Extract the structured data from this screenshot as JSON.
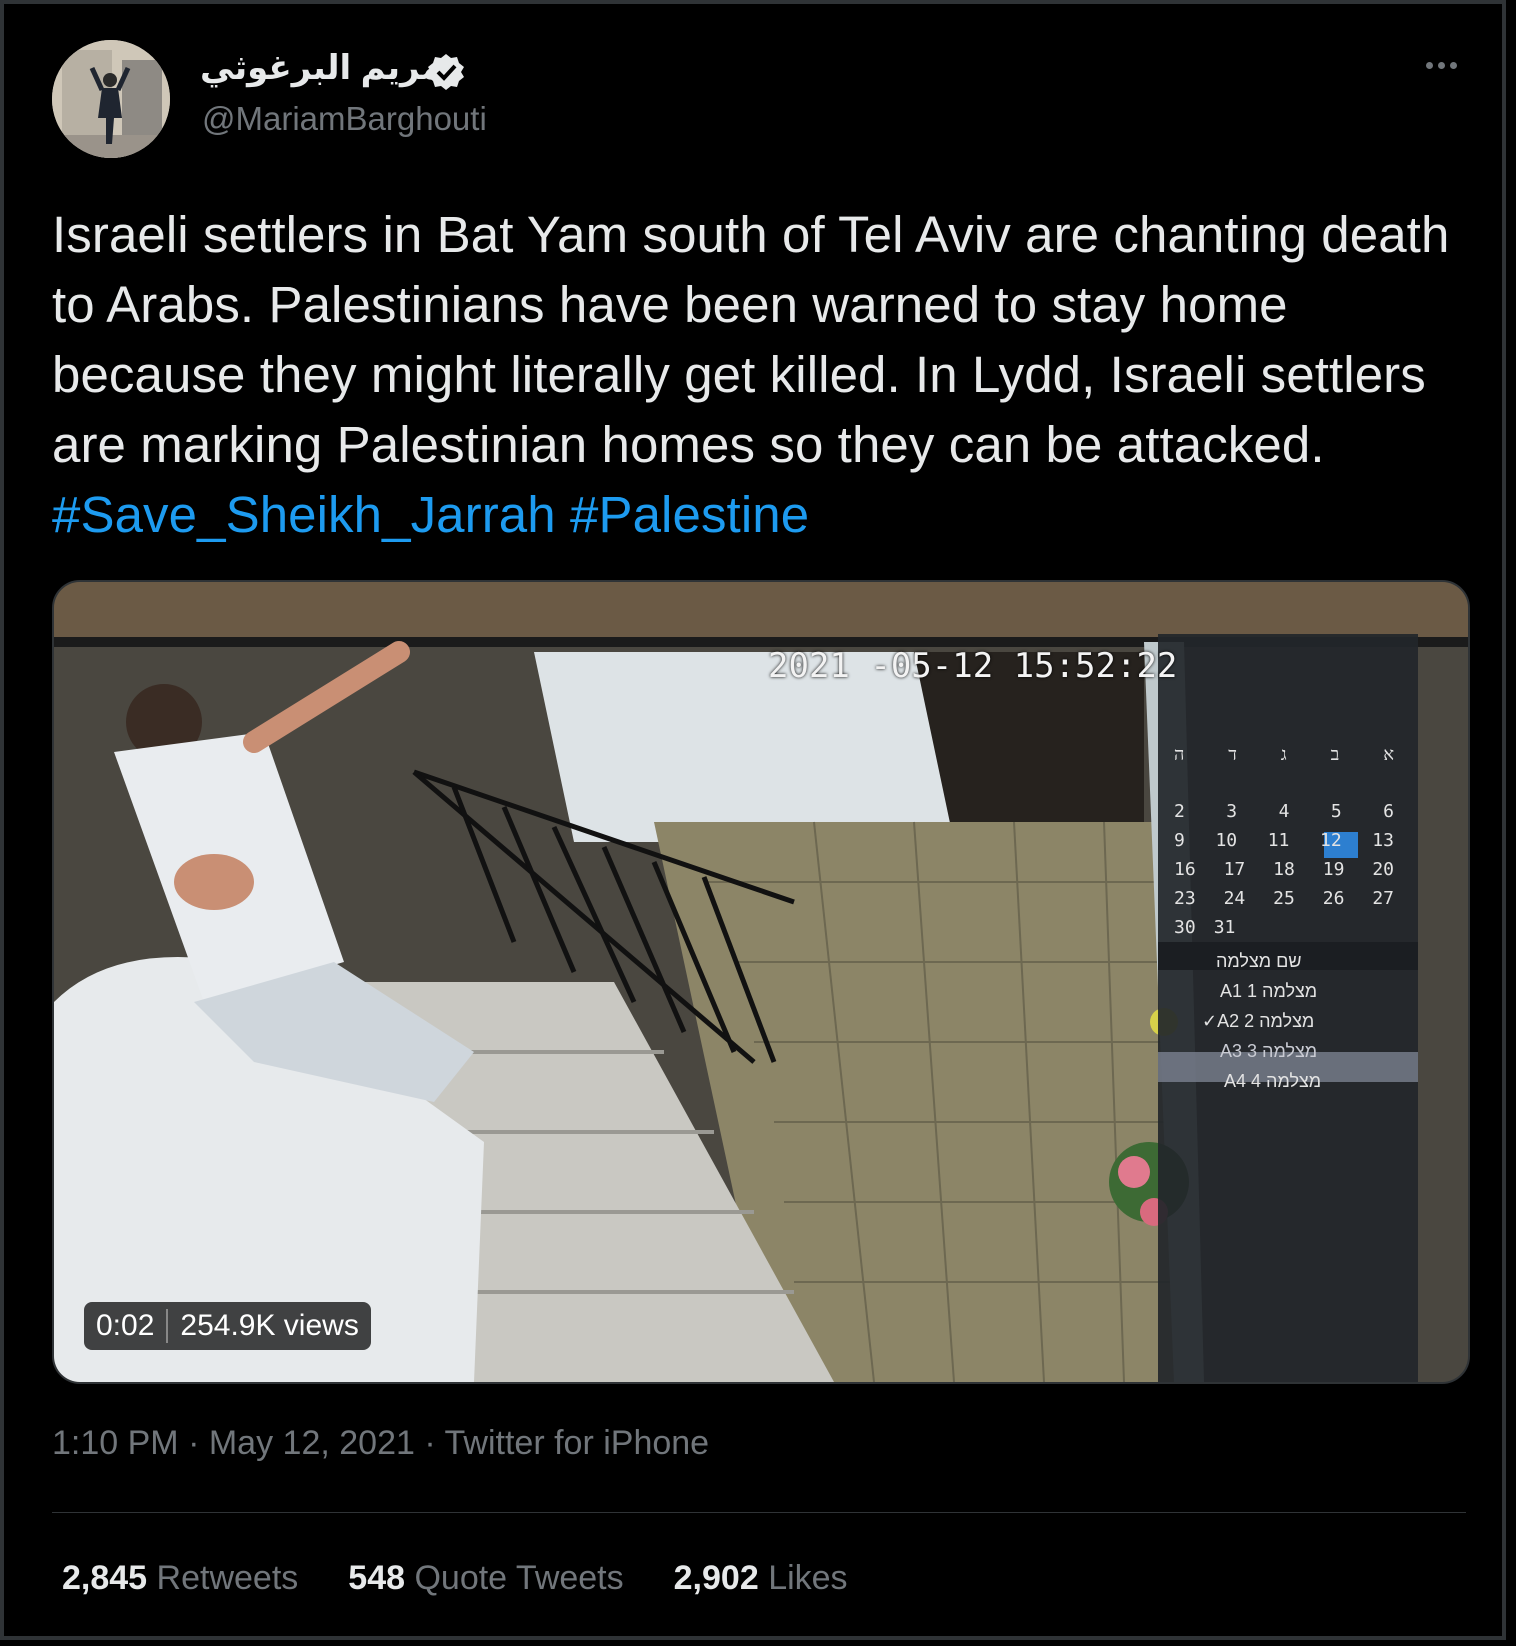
{
  "tweet": {
    "display_name": "مريم البرغوثي",
    "handle": "@MariamBarghouti",
    "verified_icon": "verified-badge-icon",
    "more_icon": "more-options-icon",
    "text_plain": "Israeli settlers in Bat Yam south of Tel Aviv are chanting death to Arabs. Palestinians have been warned to stay home because they might literally get killed. In Lydd, Israeli settlers are marking Palestinian homes so they can be attacked.",
    "hashtags": [
      "#Save_Sheikh_Jarrah",
      "#Palestine"
    ],
    "hashtag_color": "#1d9bf0"
  },
  "video": {
    "cctv_timestamp": "2021 -05-12 15:52:22",
    "duration": "0:02",
    "views": "254.9K views",
    "calendar_days": [
      [
        "2",
        "3",
        "4",
        "5",
        "6"
      ],
      [
        "9",
        "10",
        "11",
        "12",
        "13"
      ],
      [
        "16",
        "17",
        "18",
        "19",
        "20"
      ],
      [
        "23",
        "24",
        "25",
        "26",
        "27"
      ],
      [
        "30",
        "31",
        "",
        "",
        ""
      ]
    ],
    "calendar_weekdays": [
      "א",
      "ב",
      "ג",
      "ד",
      "ה"
    ],
    "camera_list_title": "שם מצלמה",
    "camera_list": [
      "A1 1 מצלמה",
      "✓A2 2 מצלמה",
      "A3 3 מצלמה",
      "A4 4 מצלמה"
    ]
  },
  "meta": {
    "time": "1:10 PM",
    "sep": "·",
    "date": "May 12, 2021",
    "source": "Twitter for iPhone"
  },
  "stats": {
    "retweets_count": "2,845",
    "retweets_label": "Retweets",
    "quotes_count": "548",
    "quotes_label": "Quote Tweets",
    "likes_count": "2,902",
    "likes_label": "Likes"
  }
}
